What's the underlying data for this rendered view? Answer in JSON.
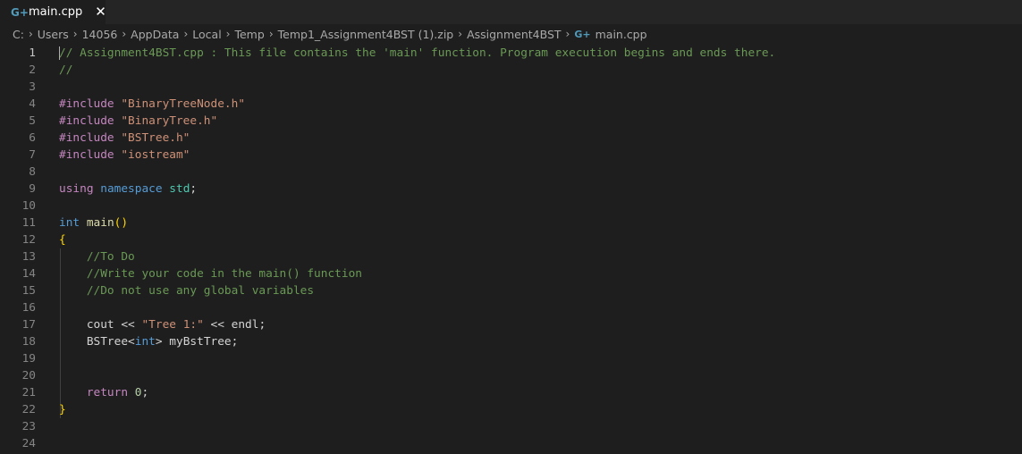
{
  "tab": {
    "icon": "G+",
    "icon_name": "cpp-file-icon",
    "title": "main.cpp",
    "close": "✕"
  },
  "breadcrumb": {
    "segments": [
      "C:",
      "Users",
      "14056",
      "AppData",
      "Local",
      "Temp",
      "Temp1_Assignment4BST (1).zip",
      "Assignment4BST"
    ],
    "separator": "›",
    "file_icon": "G+",
    "file": "main.cpp"
  },
  "editor": {
    "active_line": 1,
    "lines": [
      [
        {
          "t": "// Assignment4BST.cpp : This file contains the 'main' function. Program execution begins and ends there.",
          "c": "comment"
        }
      ],
      [
        {
          "t": "//",
          "c": "comment"
        }
      ],
      [],
      [
        {
          "t": "#include ",
          "c": "include"
        },
        {
          "t": "\"BinaryTreeNode.h\"",
          "c": "string"
        }
      ],
      [
        {
          "t": "#include ",
          "c": "include"
        },
        {
          "t": "\"BinaryTree.h\"",
          "c": "string"
        }
      ],
      [
        {
          "t": "#include ",
          "c": "include"
        },
        {
          "t": "\"BSTree.h\"",
          "c": "string"
        }
      ],
      [
        {
          "t": "#include ",
          "c": "include"
        },
        {
          "t": "\"iostream\"",
          "c": "string"
        }
      ],
      [],
      [
        {
          "t": "using ",
          "c": "include"
        },
        {
          "t": "namespace ",
          "c": "keyword"
        },
        {
          "t": "std",
          "c": "ns"
        },
        {
          "t": ";",
          "c": "text"
        }
      ],
      [],
      [
        {
          "t": "int ",
          "c": "keyword"
        },
        {
          "t": "main",
          "c": "fn"
        },
        {
          "t": "()",
          "c": "brace"
        }
      ],
      [
        {
          "t": "{",
          "c": "brace"
        }
      ],
      [
        {
          "t": "    //To Do",
          "c": "comment"
        }
      ],
      [
        {
          "t": "    //Write your code in the main() function",
          "c": "comment"
        }
      ],
      [
        {
          "t": "    //Do not use any global variables",
          "c": "comment"
        }
      ],
      [],
      [
        {
          "t": "    cout ",
          "c": "text"
        },
        {
          "t": "<< ",
          "c": "text"
        },
        {
          "t": "\"Tree 1:\"",
          "c": "string"
        },
        {
          "t": " << endl;",
          "c": "text"
        }
      ],
      [
        {
          "t": "    BSTree",
          "c": "text"
        },
        {
          "t": "<",
          "c": "text"
        },
        {
          "t": "int",
          "c": "keyword"
        },
        {
          "t": "> myBstTree;",
          "c": "text"
        }
      ],
      [],
      [],
      [
        {
          "t": "    return ",
          "c": "include"
        },
        {
          "t": "0",
          "c": "num"
        },
        {
          "t": ";",
          "c": "text"
        }
      ],
      [
        {
          "t": "}",
          "c": "brace"
        }
      ],
      [],
      []
    ]
  }
}
